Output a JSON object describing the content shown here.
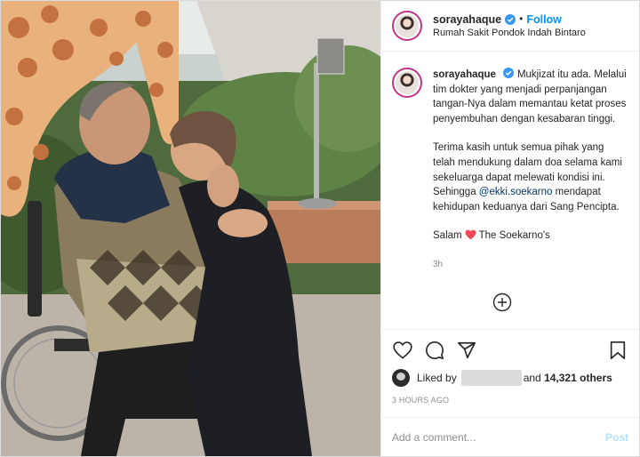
{
  "header": {
    "username": "sorayahaque",
    "follow_label": "Follow",
    "separator": "•",
    "location": "Rumah Sakit Pondok Indah Bintaro"
  },
  "caption": {
    "username": "sorayahaque",
    "paragraph1": "Mukjizat itu ada. Melalui tim dokter yang menjadi perpanjangan tangan-Nya dalam memantau ketat proses penyembuhan dengan kesabaran tinggi.",
    "paragraph2_before": "Terima kasih untuk semua pihak yang telah mendukung dalam doa selama kami sekeluarga dapat melewati kondisi ini. Sehingga ",
    "mention": "@ekki.soekarno",
    "paragraph2_after": " mendapat kehidupan keduanya dari Sang Pencipta.",
    "closing_before": "Salam",
    "closing_after": "The Soekarno's",
    "time_ago": "3h"
  },
  "likes": {
    "prefix": "Liked by",
    "and_text": "and",
    "count_text": "14,321 others"
  },
  "post_time": "3 HOURS AGO",
  "add_comment": {
    "placeholder": "Add a comment...",
    "post_label": "Post"
  },
  "icons": {
    "verified": "verified-badge-icon",
    "load_more": "plus-circle-icon",
    "like": "heart-icon",
    "comment": "comment-icon",
    "share": "paper-plane-icon",
    "save": "bookmark-icon"
  },
  "colors": {
    "link_blue": "#0095f6",
    "mention": "#00376b",
    "heart_red": "#ed4956",
    "muted": "#8e8e8e"
  }
}
